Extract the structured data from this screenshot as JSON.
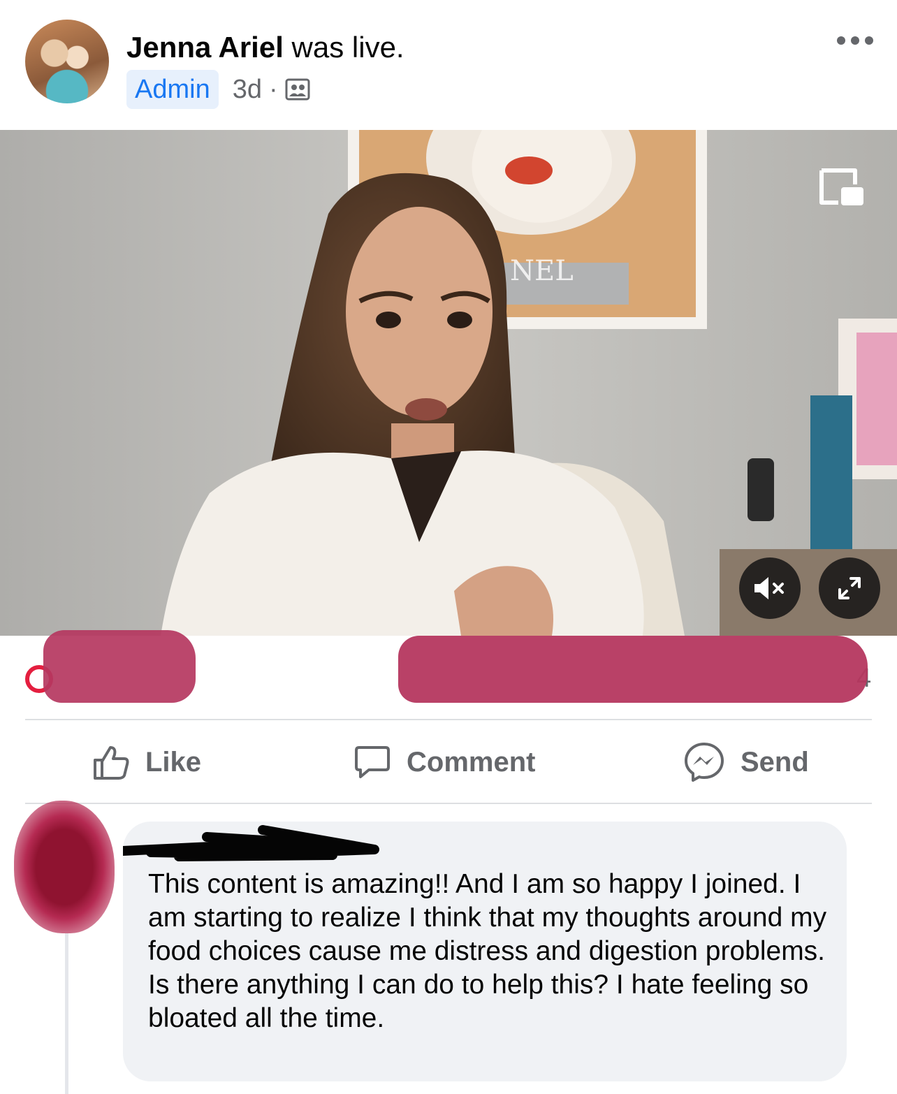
{
  "post": {
    "author_name": "Jenna Ariel",
    "status_text": "was live.",
    "badge": "Admin",
    "time": "3d",
    "dot": "·",
    "audience_icon": "group-icon",
    "more_icon": "more-horizontal-icon"
  },
  "video": {
    "pip_icon": "picture-in-picture-icon",
    "mute_icon": "muted-speaker-icon",
    "expand_icon": "expand-icon"
  },
  "stats": {
    "count_fragment": "4"
  },
  "actions": {
    "like_label": "Like",
    "comment_label": "Comment",
    "send_label": "Send"
  },
  "comment": {
    "text": "This content is amazing!! And I am so happy I joined. I am starting to realize I think that my thoughts around my food choices cause me distress and digestion problems. Is there anything I can do to help this? I hate feeling so bloated all the time."
  },
  "colors": {
    "link_blue": "#1877f2",
    "secondary_text": "#65676b",
    "redaction": "#b5375f",
    "bubble_bg": "#f0f2f5"
  }
}
